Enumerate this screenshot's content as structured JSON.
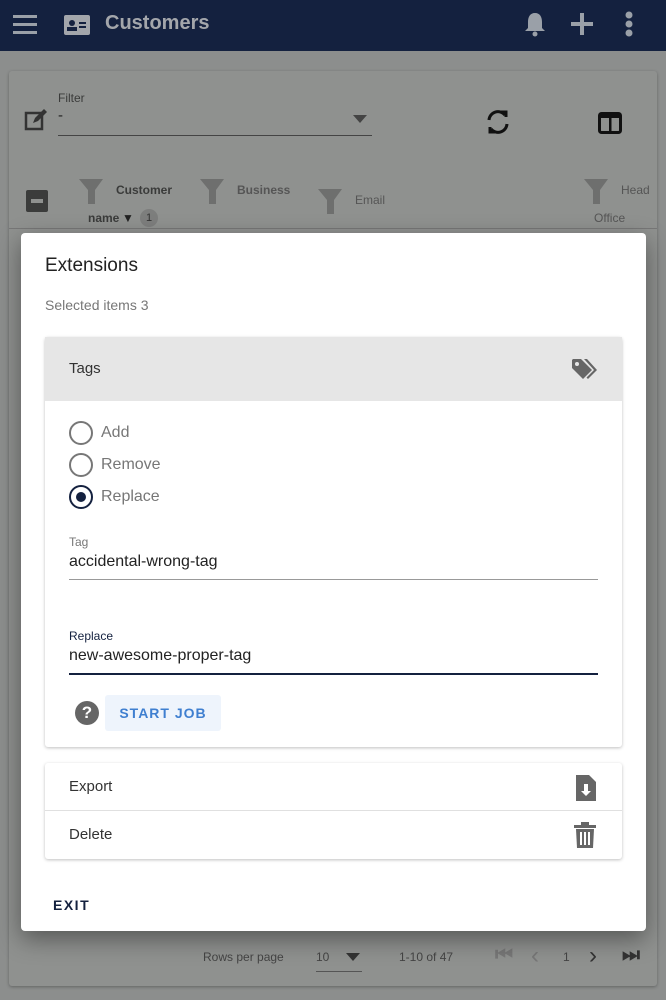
{
  "appbar": {
    "title": "Customers",
    "icons": [
      "menu-icon",
      "contact-card-icon",
      "bell-icon",
      "plus-icon",
      "more-vert-icon"
    ]
  },
  "filter": {
    "label": "Filter",
    "value": "-"
  },
  "table": {
    "columns": [
      {
        "line1": "Customer",
        "line2": "name",
        "sort_badge": "1"
      },
      {
        "line1": "Business"
      },
      {
        "line1": "Email"
      },
      {
        "line1": "Head",
        "line2": "Office"
      }
    ]
  },
  "pagination": {
    "rows_label": "Rows per page",
    "rows_value": "10",
    "range": "1-10 of 47",
    "page": "1"
  },
  "dialog": {
    "title": "Extensions",
    "subtitle": "Selected items 3",
    "tags": {
      "header": "Tags",
      "options": [
        {
          "label": "Add",
          "selected": false
        },
        {
          "label": "Remove",
          "selected": false
        },
        {
          "label": "Replace",
          "selected": true
        }
      ],
      "tag_label": "Tag",
      "tag_value": "accidental-wrong-tag",
      "replace_label": "Replace",
      "replace_value": "new-awesome-proper-tag",
      "start_label": "START JOB"
    },
    "export_label": "Export",
    "delete_label": "Delete",
    "exit_label": "EXIT"
  },
  "colors": {
    "primary": "#14213f",
    "accent": "#3f7fd0"
  }
}
